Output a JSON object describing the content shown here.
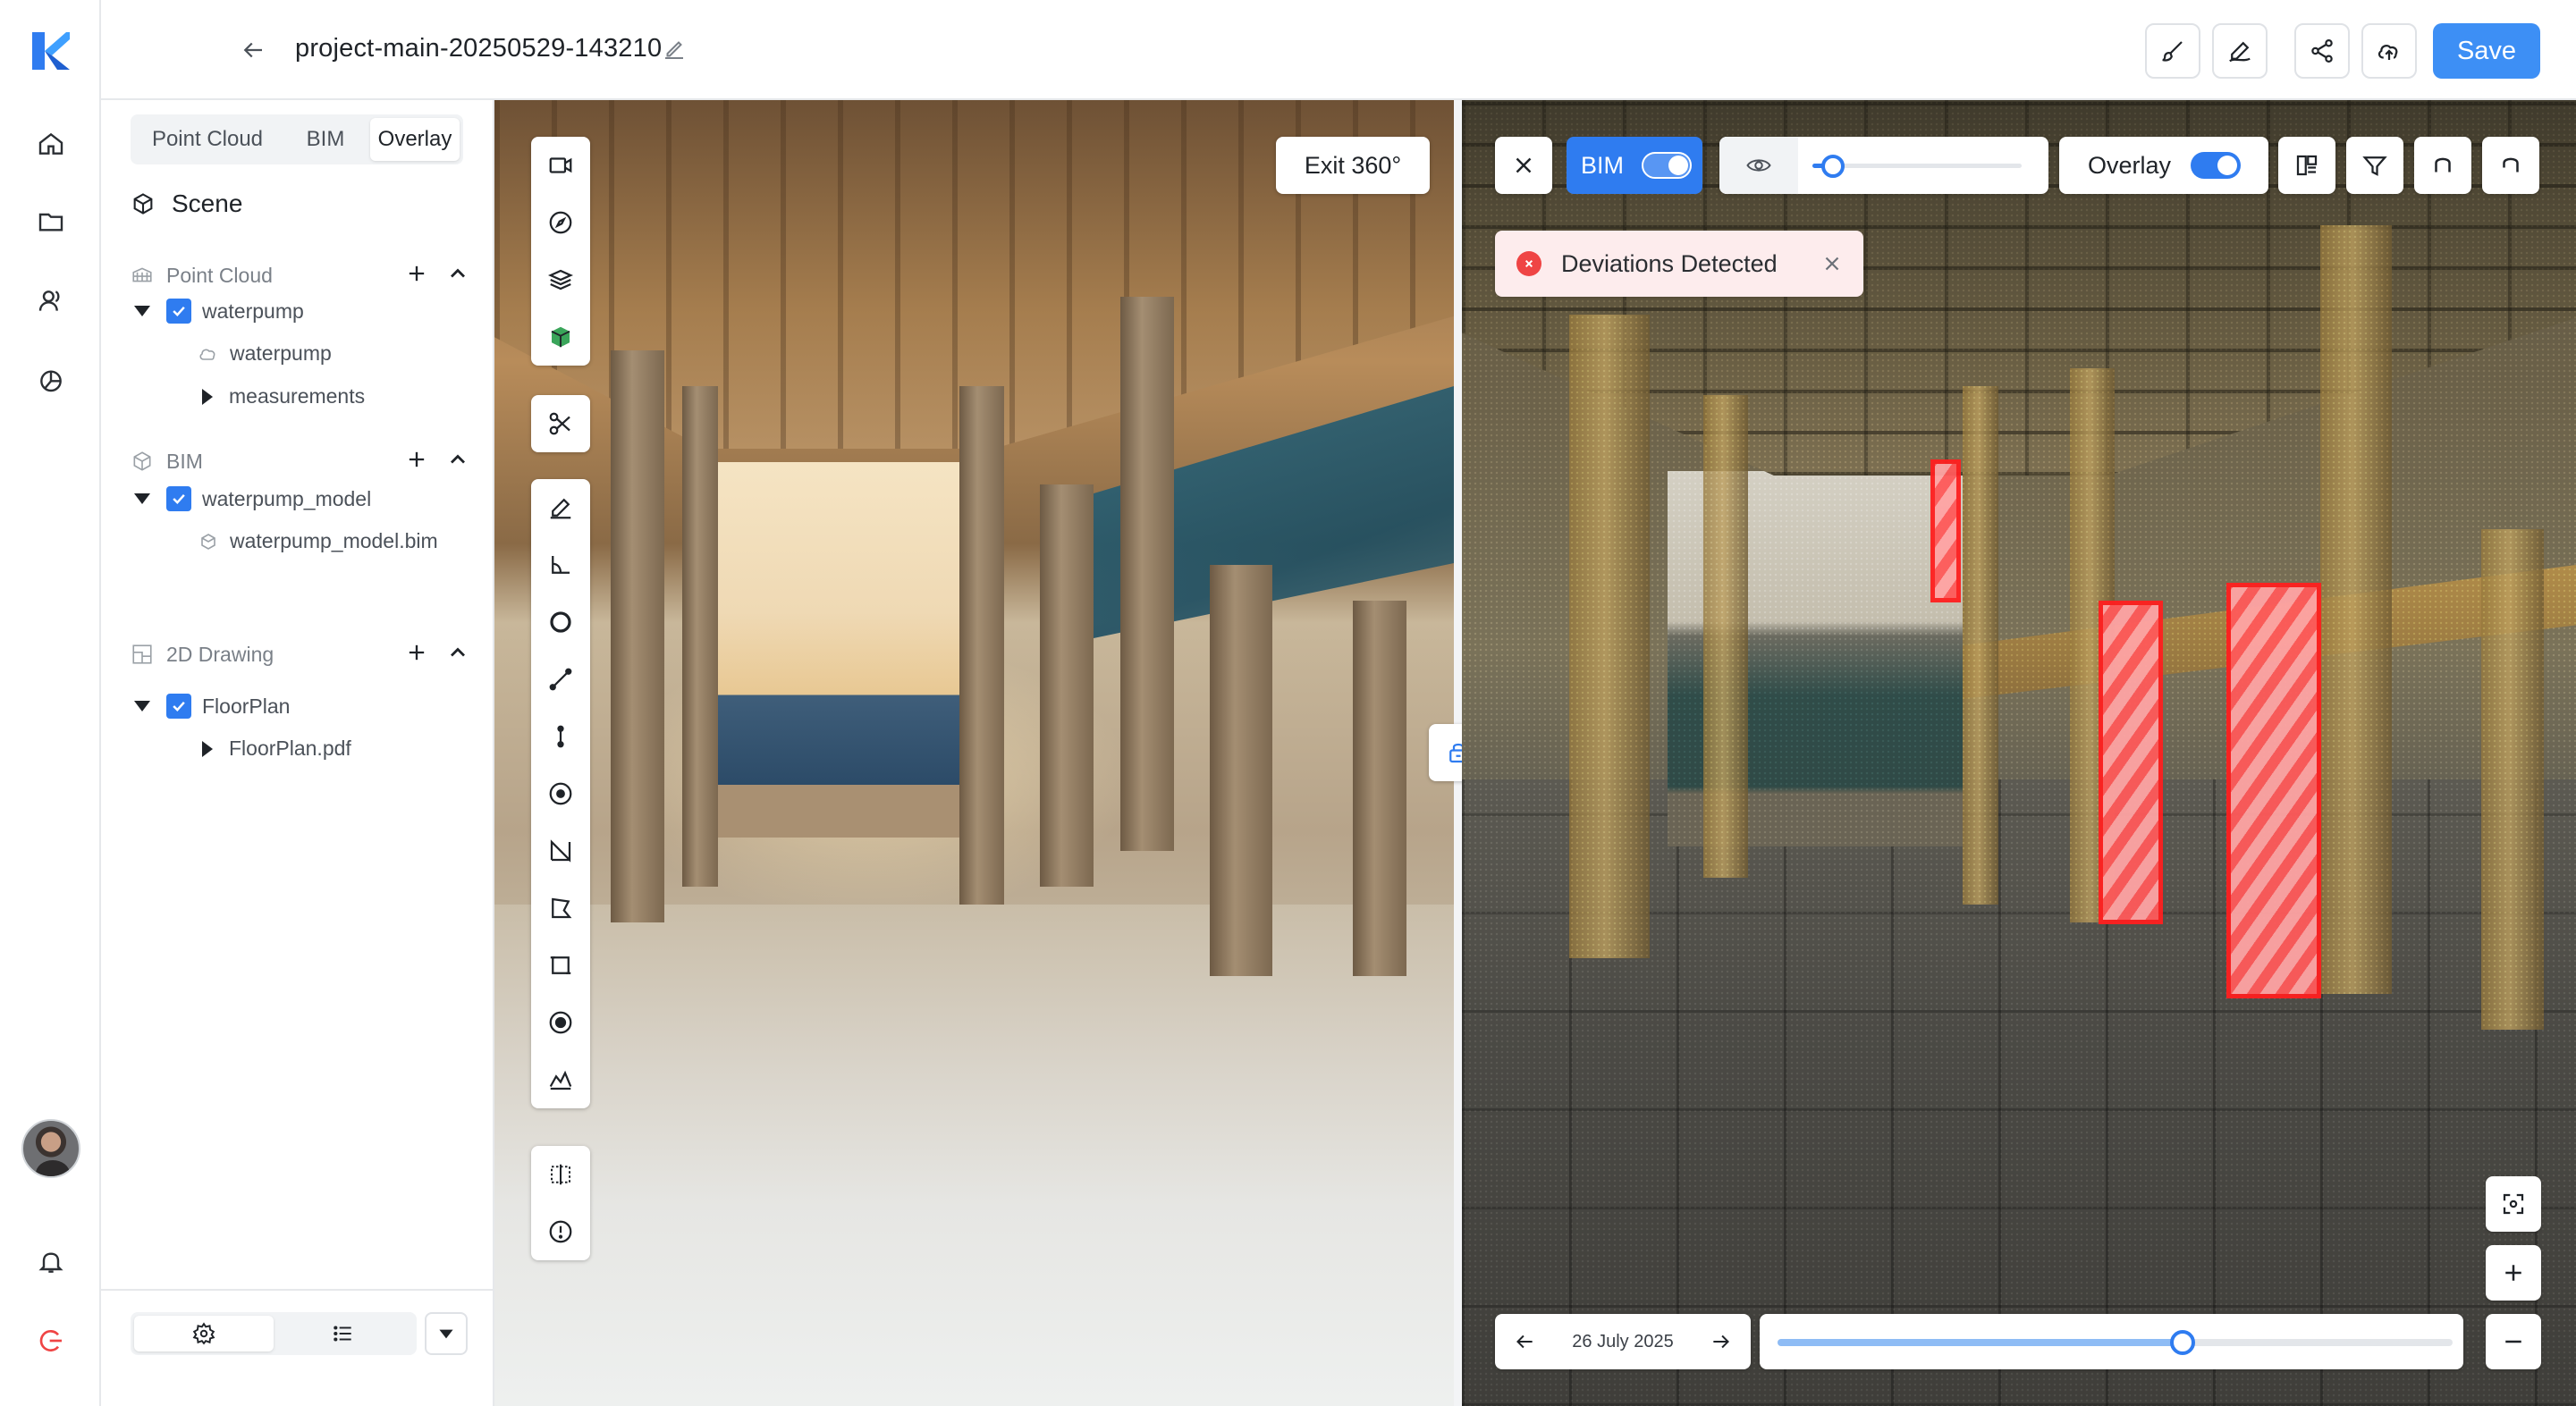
{
  "app": {
    "project_title": "project-main-20250529-143210",
    "save_label": "Save",
    "accent_color": "#2f7cf0",
    "rail_icons": [
      "home-icon",
      "folder-icon",
      "users-icon",
      "analytics-icon",
      "bell-icon",
      "logout-icon"
    ],
    "toolbar_icons": [
      "brush-icon",
      "markup-pen-icon",
      "share-icon",
      "cloud-upload-icon"
    ]
  },
  "panel": {
    "mode_tabs": [
      {
        "label": "Point Cloud",
        "active": false
      },
      {
        "label": "BIM",
        "active": false
      },
      {
        "label": "Overlay",
        "active": true
      }
    ],
    "scene_label": "Scene",
    "sections": {
      "point_cloud": {
        "label": "Point Cloud",
        "item": "waterpump",
        "children": [
          "waterpump",
          "measurements"
        ]
      },
      "bim": {
        "label": "BIM",
        "item": "waterpump_model",
        "children": [
          "waterpump_model.bim"
        ]
      },
      "drawing": {
        "label": "2D Drawing",
        "item": "FloorPlan",
        "children": [
          "FloorPlan.pdf"
        ]
      }
    },
    "footer_tabs": [
      "settings-icon",
      "list-icon"
    ]
  },
  "photo_view": {
    "exit_label": "Exit 360°",
    "tool_groups": [
      [
        "camera-icon",
        "compass-icon",
        "layers-icon",
        "cube-icon"
      ],
      [
        "scissors-icon"
      ],
      [
        "pen-icon",
        "angle-icon",
        "circle-icon",
        "line-icon",
        "point-icon",
        "target-icon",
        "north-icon",
        "polygon-icon",
        "area-icon",
        "radius-icon",
        "profile-icon"
      ],
      [
        "split-icon",
        "info-icon"
      ]
    ]
  },
  "bim_view": {
    "bim_toggle_label": "BIM",
    "bim_toggle_on": true,
    "opacity_level": 0.1,
    "overlay_toggle_label": "Overlay",
    "overlay_toggle_on": true,
    "alert_text": "Deviations Detected",
    "date_label": "26 July 2025",
    "timeline_position": 0.6,
    "deviation_color": "#ff1f1f"
  }
}
